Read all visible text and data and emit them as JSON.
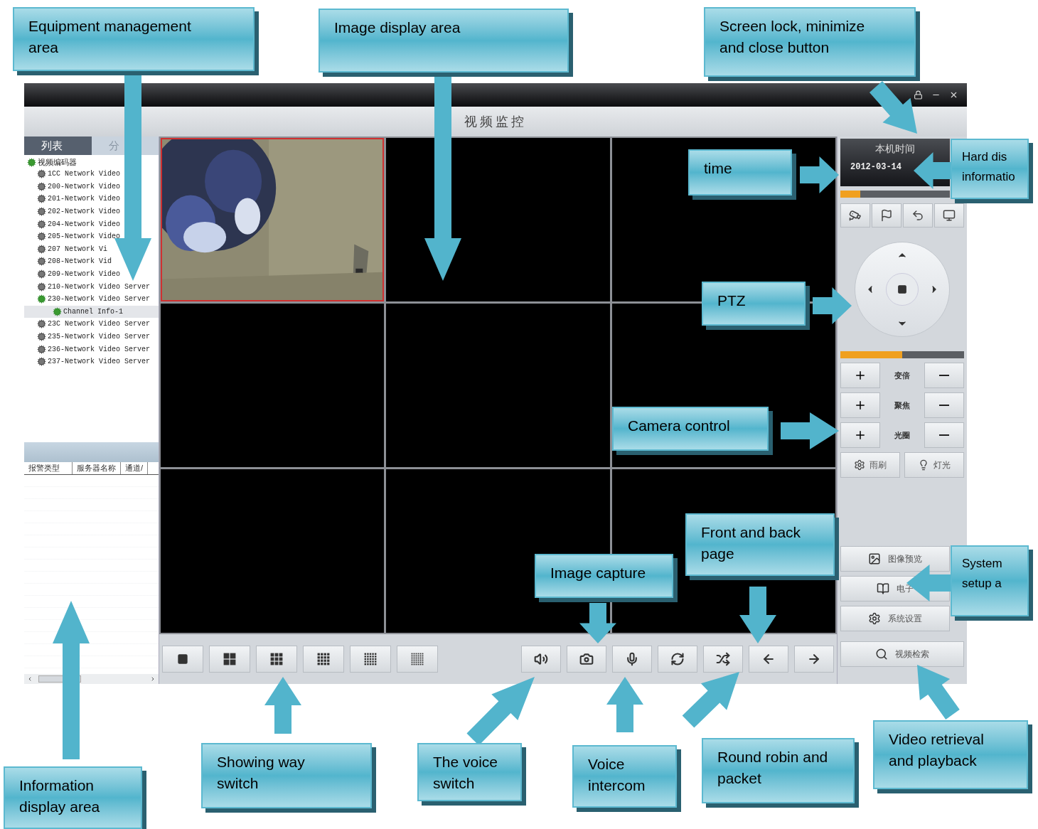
{
  "window": {
    "title": "视频监控"
  },
  "left_panel": {
    "tabs": [
      {
        "label": "列表",
        "selected": true
      },
      {
        "label": "分",
        "selected": false
      }
    ],
    "tree": {
      "label": "视频编码器",
      "children": [
        {
          "label": "1CC Network Video",
          "online": false,
          "selected": false
        },
        {
          "label": "200-Network Video",
          "online": false,
          "selected": false
        },
        {
          "label": "201-Network Video",
          "online": false,
          "selected": false
        },
        {
          "label": "202-Network Video",
          "online": false,
          "selected": false
        },
        {
          "label": "204-Network Video",
          "online": false,
          "selected": false
        },
        {
          "label": "205-Network Video",
          "online": false,
          "selected": false
        },
        {
          "label": "207 Network Vi",
          "online": false,
          "selected": false
        },
        {
          "label": "208-Network Vid",
          "online": false,
          "selected": false
        },
        {
          "label": "209-Network Video",
          "online": false,
          "selected": false
        },
        {
          "label": "210-Network Video Server",
          "online": false,
          "selected": false
        },
        {
          "label": "230-Network Video Server",
          "online": true,
          "selected": false,
          "children": [
            {
              "label": "Channel Info-1",
              "online": true,
              "selected": true
            }
          ]
        },
        {
          "label": "23C Network Video Server",
          "online": false,
          "selected": false
        },
        {
          "label": "235-Network Video Server",
          "online": false,
          "selected": false
        },
        {
          "label": "236-Network Video Server",
          "online": false,
          "selected": false
        },
        {
          "label": "237-Network Video Server",
          "online": false,
          "selected": false
        }
      ]
    },
    "table": {
      "columns": [
        "报警类型",
        "服务器名称",
        "通道/"
      ]
    }
  },
  "video_grid": {
    "cells": [
      {
        "kind": "picture",
        "selected": true
      },
      {
        "kind": "empty",
        "selected": false
      },
      {
        "kind": "empty",
        "selected": false
      },
      {
        "kind": "empty",
        "selected": false
      },
      {
        "kind": "empty",
        "selected": false
      },
      {
        "kind": "empty",
        "selected": false
      },
      {
        "kind": "empty",
        "selected": false
      },
      {
        "kind": "empty",
        "selected": false
      },
      {
        "kind": "empty",
        "selected": false
      }
    ]
  },
  "right_panel": {
    "time_title": "本机时间",
    "date": "2012-03-14",
    "disk_bar": {
      "level": 0.18
    },
    "ptz_speed": {
      "level": 0.5
    },
    "camera_controls": [
      {
        "label": "变倍"
      },
      {
        "label": "聚焦"
      },
      {
        "label": "光圈"
      }
    ],
    "toggles": [
      {
        "kind": "wiper",
        "label": "雨刷"
      },
      {
        "kind": "light",
        "label": "灯光"
      }
    ],
    "functions": [
      {
        "kind": "preview",
        "label": "图像预览"
      },
      {
        "kind": "map",
        "label": "电子"
      },
      {
        "kind": "settings",
        "label": "系统设置"
      },
      {
        "kind": "search",
        "label": "视频检索"
      }
    ]
  },
  "callouts": [
    {
      "lines": [
        "Equipment management",
        "area"
      ]
    },
    {
      "lines": [
        "Image display area"
      ]
    },
    {
      "lines": [
        "Screen lock, minimize",
        "and close button"
      ]
    },
    {
      "lines": [
        "time"
      ]
    },
    {
      "lines": [
        "Hard dis",
        "informatio"
      ]
    },
    {
      "lines": [
        "PTZ"
      ]
    },
    {
      "lines": [
        "Camera control"
      ]
    },
    {
      "lines": [
        "Front and back",
        "page"
      ]
    },
    {
      "lines": [
        "Image capture"
      ]
    },
    {
      "lines": [
        "System",
        "setup a"
      ]
    },
    {
      "lines": [
        "Information",
        "display area"
      ]
    },
    {
      "lines": [
        "Showing way",
        "switch"
      ]
    },
    {
      "lines": [
        "The voice",
        "switch"
      ]
    },
    {
      "lines": [
        "Voice",
        "intercom"
      ]
    },
    {
      "lines": [
        "Round robin and",
        "packet"
      ]
    },
    {
      "lines": [
        "Video retrieval",
        "and playback"
      ]
    }
  ]
}
